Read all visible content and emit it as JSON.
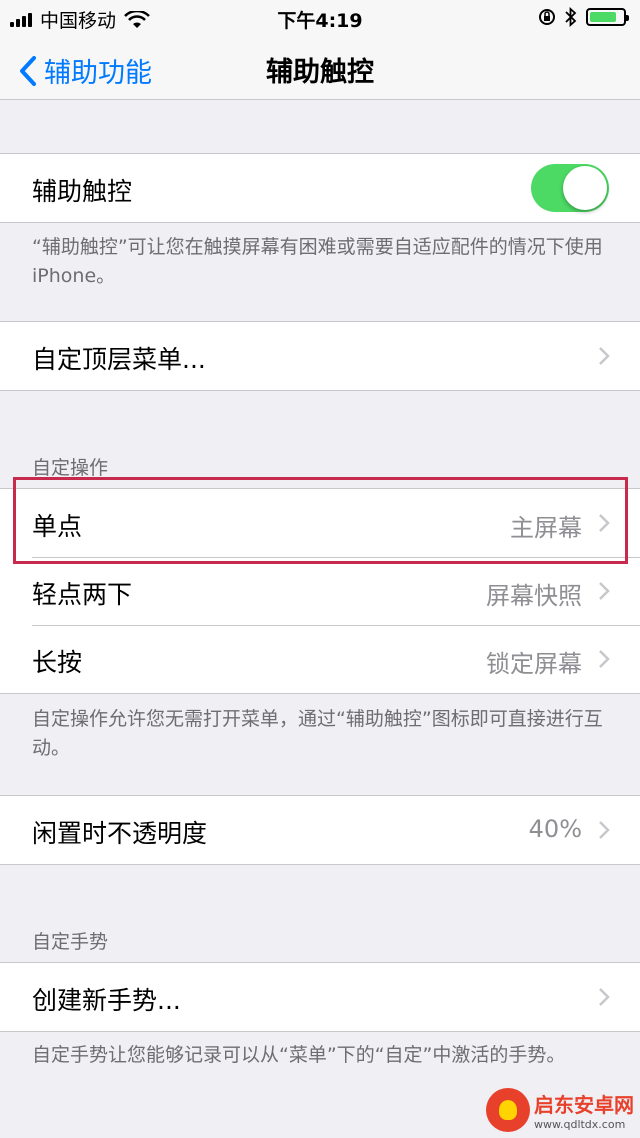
{
  "status_bar": {
    "carrier": "中国移动",
    "time": "下午4:19",
    "battery_level": 0.8
  },
  "nav": {
    "back_label": "辅助功能",
    "title": "辅助触控"
  },
  "assistive_touch": {
    "label": "辅助触控",
    "enabled": true,
    "footer": "“辅助触控”可让您在触摸屏幕有困难或需要自适应配件的情况下使用 iPhone。"
  },
  "top_menu": {
    "label": "自定顶层菜单..."
  },
  "custom_actions": {
    "header": "自定操作",
    "items": [
      {
        "label": "单点",
        "value": "主屏幕"
      },
      {
        "label": "轻点两下",
        "value": "屏幕快照"
      },
      {
        "label": "长按",
        "value": "锁定屏幕"
      }
    ],
    "footer": "自定操作允许您无需打开菜单，通过“辅助触控”图标即可直接进行互动。"
  },
  "idle_opacity": {
    "label": "闲置时不透明度",
    "value": "40%"
  },
  "custom_gestures": {
    "header": "自定手势",
    "create_label": "创建新手势...",
    "footer": "自定手势让您能够记录可以从“菜单”下的“自定”中激活的手势。"
  },
  "watermark": {
    "main": "启东安卓网",
    "sub": "www.qdltdx.com"
  },
  "colors": {
    "accent": "#007aff",
    "toggle_on": "#4cd964",
    "highlight": "#c72a4c"
  }
}
